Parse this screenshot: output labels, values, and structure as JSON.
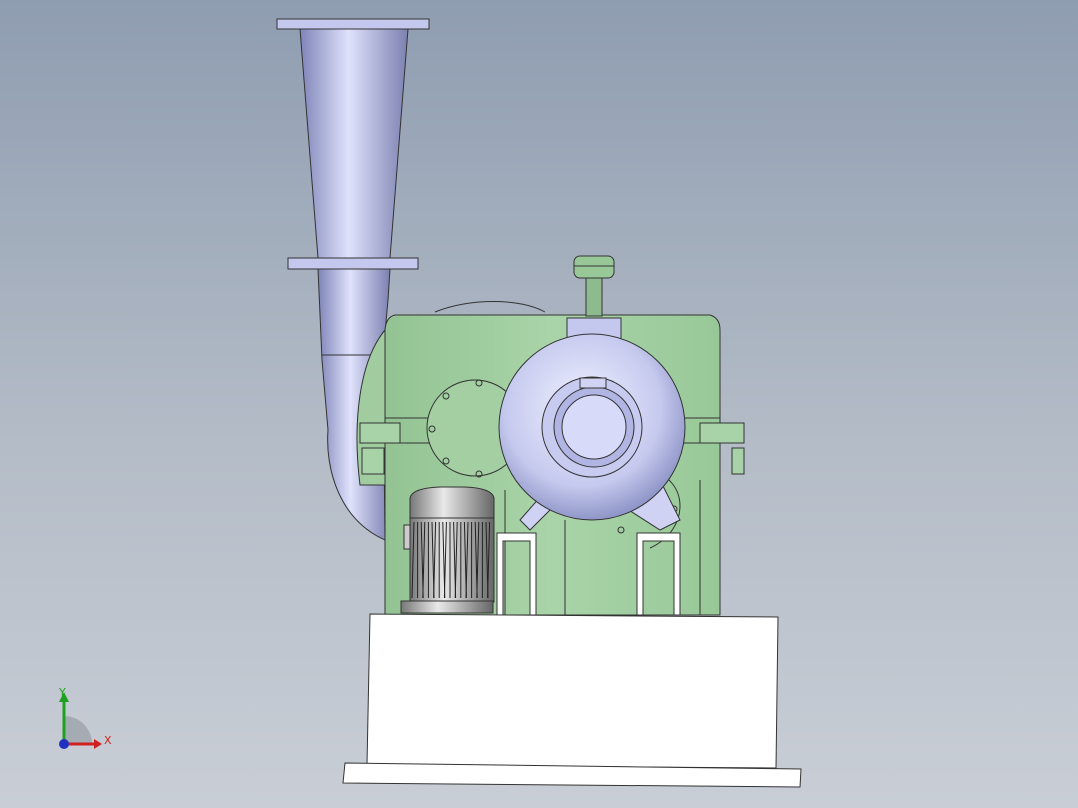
{
  "view": {
    "background_top": "#8f9db1",
    "background_bottom": "#c9ced6",
    "model_colors": {
      "housing_green": "#a3cfa3",
      "duct_blue": "#b8bde6",
      "base_white": "#ffffff",
      "motor_grey": "#9a9a9a",
      "edge_dark": "#333333"
    }
  },
  "triad": {
    "x_label": "X",
    "y_label": "Y",
    "x_color": "#d02020",
    "y_color": "#20a020",
    "z_color": "#2030c0"
  }
}
